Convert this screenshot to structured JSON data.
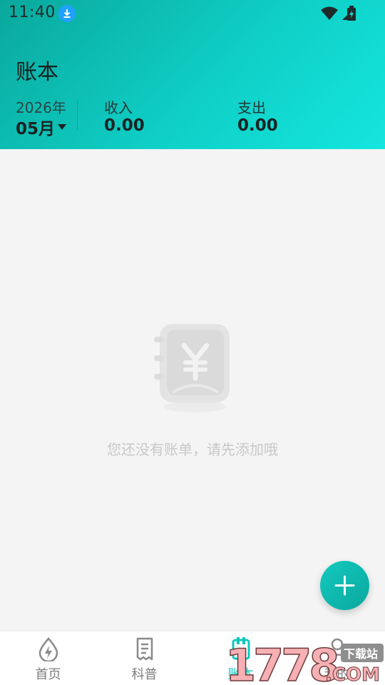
{
  "status_bar": {
    "time": "11:40"
  },
  "header": {
    "title": "账本",
    "year": "2026年",
    "month": "05月",
    "income_label": "收入",
    "income_value": "0.00",
    "expense_label": "支出",
    "expense_value": "0.00"
  },
  "empty_state": {
    "message": "您还没有账单，请先添加哦"
  },
  "tabs": [
    {
      "label": "首页",
      "icon": "drop-bolt-icon"
    },
    {
      "label": "科普",
      "icon": "receipt-icon"
    },
    {
      "label": "账本",
      "icon": "ledger-icon"
    },
    {
      "label": "我的",
      "icon": "profile-icon"
    }
  ],
  "active_tab": "账本",
  "watermark": {
    "badge": "下载站",
    "text": "1778.COM"
  },
  "colors": {
    "accent": "#10c7bd",
    "header_start": "#0aa89c",
    "header_end": "#14e6de"
  }
}
